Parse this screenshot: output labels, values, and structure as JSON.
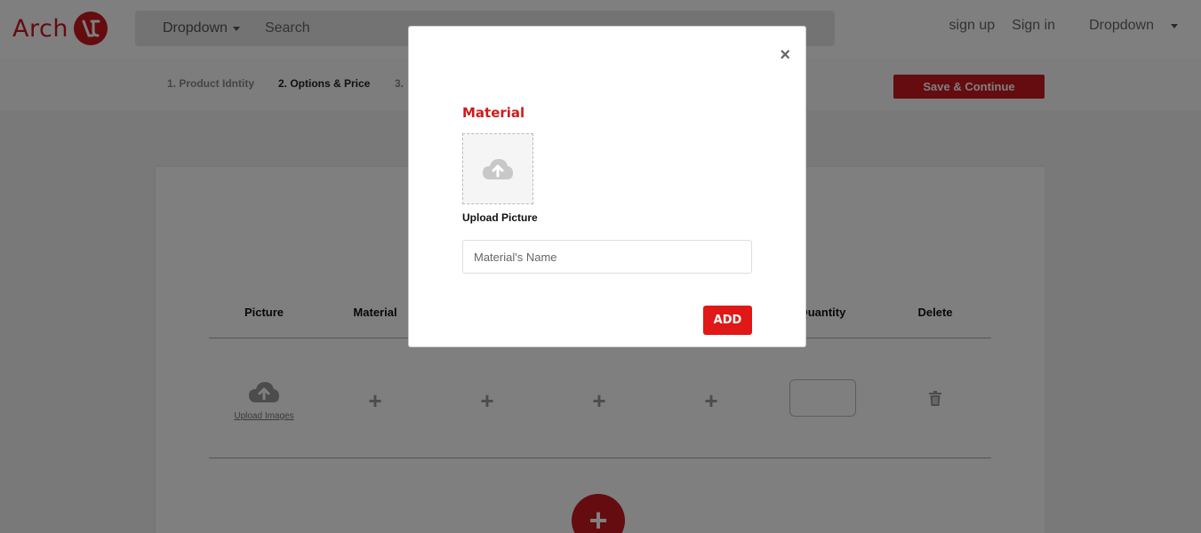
{
  "header": {
    "logo_text": "Arch",
    "nav_dropdown_label": "Dropdown",
    "search_placeholder": "Search",
    "sign_up": "sign up",
    "sign_in": "Sign in",
    "right_dropdown_label": "Dropdown"
  },
  "steps": {
    "items": [
      {
        "label": "1. Product Idntity",
        "active": false
      },
      {
        "label": "2. Options & Price",
        "active": true
      },
      {
        "label": "3.",
        "active": false
      }
    ],
    "save_label": "Save & Continue"
  },
  "table": {
    "headers": [
      "Picture",
      "Material",
      "",
      "",
      "",
      "Quantity",
      "Delete"
    ],
    "upload_images_label": "Upload Images"
  },
  "modal": {
    "title": "Material",
    "upload_label": "Upload Picture",
    "name_placeholder": "Material's Name",
    "add_label": "ADD",
    "close_glyph": "×"
  },
  "colors": {
    "brand_red": "#c8181e",
    "add_red": "#e01818"
  },
  "icons": [
    "cloud-upload-icon",
    "plus-icon",
    "trash-icon",
    "close-icon",
    "chevron-down-icon"
  ]
}
